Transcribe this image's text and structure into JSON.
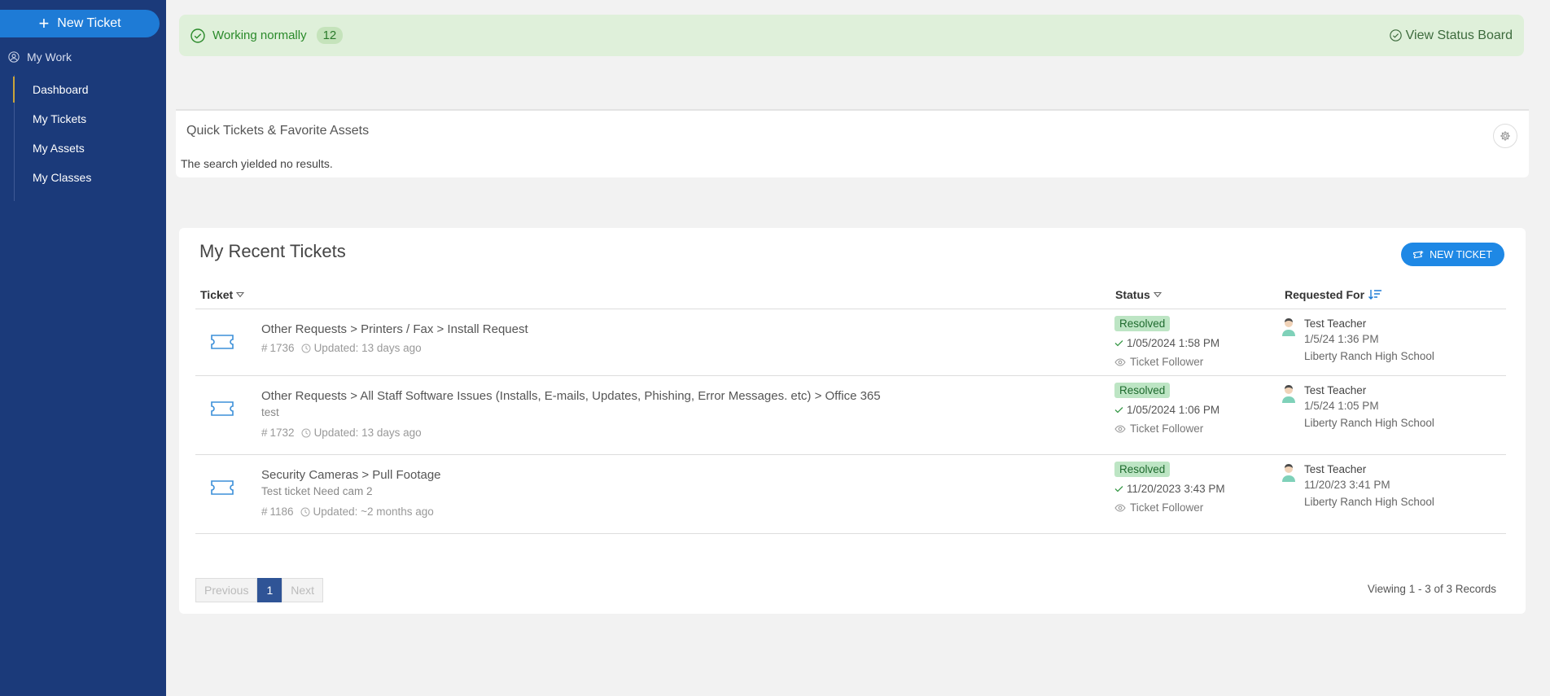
{
  "sidebar": {
    "new_ticket_label": "New Ticket",
    "my_work_label": "My Work",
    "items": [
      {
        "label": "Dashboard"
      },
      {
        "label": "My Tickets"
      },
      {
        "label": "My Assets"
      },
      {
        "label": "My Classes"
      }
    ],
    "active_item": "Dashboard"
  },
  "status_bar": {
    "text": "Working normally",
    "count": "12",
    "link_label": "View Status Board"
  },
  "quick_panel": {
    "title": "Quick Tickets & Favorite Assets",
    "empty_text": "The search yielded no results."
  },
  "recent_tickets": {
    "title": "My Recent Tickets",
    "new_ticket_button": "NEW TICKET",
    "columns": {
      "ticket": "Ticket",
      "status": "Status",
      "requested_for": "Requested For"
    },
    "rows": [
      {
        "path": "Other Requests > Printers / Fax > Install Request",
        "description": "",
        "number": "1736",
        "updated": "Updated: 13 days ago",
        "status": "Resolved",
        "resolved_date": "1/05/2024 1:58 PM",
        "follower": "Ticket Follower",
        "requester": "Test Teacher",
        "requested_date": "1/5/24 1:36 PM",
        "school": "Liberty Ranch High School"
      },
      {
        "path": "Other Requests > All Staff Software Issues (Installs, E-mails, Updates, Phishing, Error Messages. etc) > Office 365",
        "description": "test",
        "number": "1732",
        "updated": "Updated: 13 days ago",
        "status": "Resolved",
        "resolved_date": "1/05/2024 1:06 PM",
        "follower": "Ticket Follower",
        "requester": "Test Teacher",
        "requested_date": "1/5/24 1:05 PM",
        "school": "Liberty Ranch High School"
      },
      {
        "path": "Security Cameras > Pull Footage",
        "description": "Test ticket Need cam 2",
        "number": "1186",
        "updated": "Updated: ~2 months ago",
        "status": "Resolved",
        "resolved_date": "11/20/2023 3:43 PM",
        "follower": "Ticket Follower",
        "requester": "Test Teacher",
        "requested_date": "11/20/23 3:41 PM",
        "school": "Liberty Ranch High School"
      }
    ],
    "pager": {
      "previous": "Previous",
      "current": "1",
      "next": "Next"
    },
    "viewing": "Viewing 1 - 3 of 3 Records"
  },
  "colors": {
    "sidebar_bg": "#1b3a7a",
    "accent": "#1e7bd6",
    "status_ok": "#2a8a2a",
    "resolved_badge": "#bde5c4"
  }
}
